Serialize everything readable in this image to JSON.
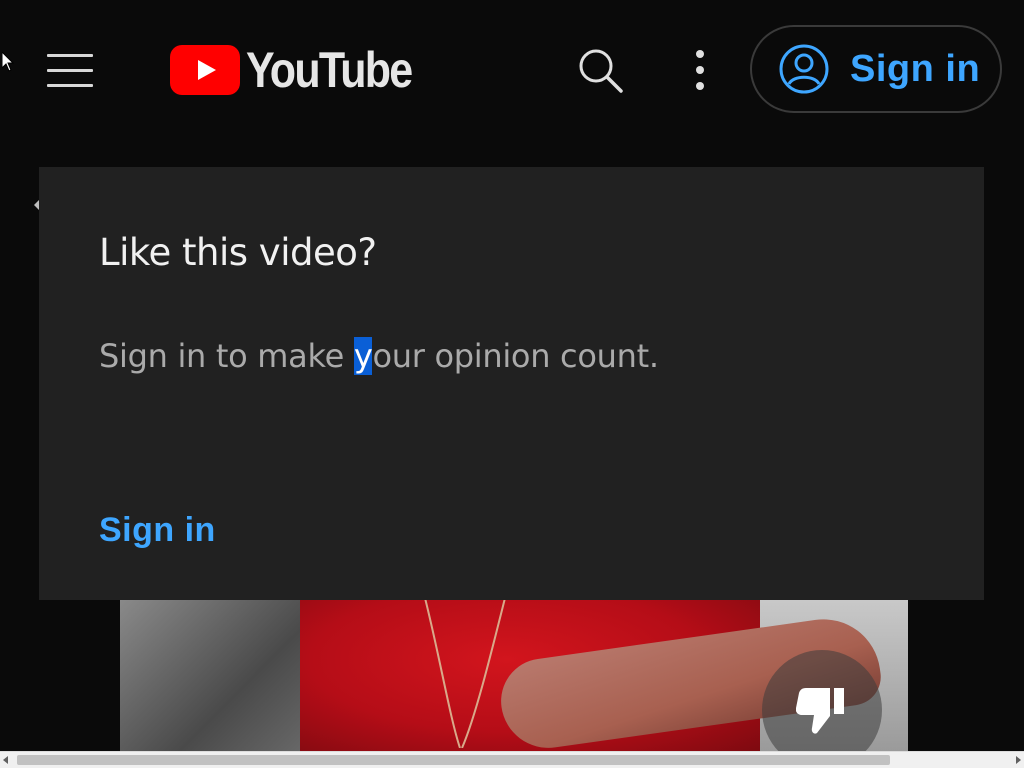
{
  "header": {
    "logo_text": "YouTube",
    "sign_in_label": "Sign in"
  },
  "dialog": {
    "title": "Like this video?",
    "body_before": "Sign in to make ",
    "body_selected": "y",
    "body_after": "our opinion count.",
    "sign_in_label": "Sign in"
  },
  "colors": {
    "accent": "#3ea6ff",
    "logo_red": "#ff0000",
    "dialog_bg": "#212121",
    "page_bg": "#0a0a0a",
    "selection": "#0a5fd6"
  },
  "icons": {
    "menu": "hamburger-menu-icon",
    "logo": "youtube-play-icon",
    "search": "search-icon",
    "more": "more-vertical-icon",
    "account": "account-circle-icon",
    "dislike": "thumbs-down-icon",
    "cursor": "mouse-pointer-icon"
  }
}
